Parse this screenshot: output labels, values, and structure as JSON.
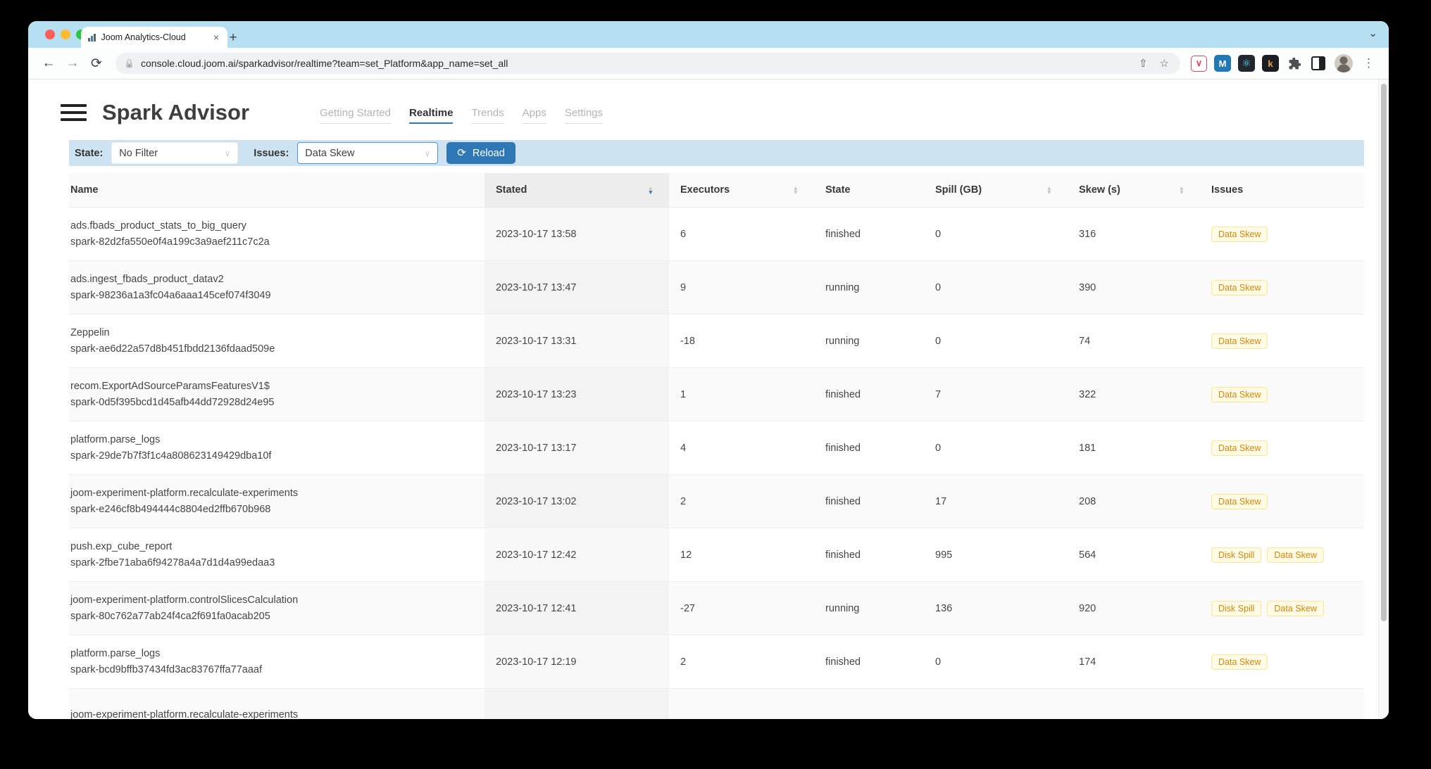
{
  "colors": {
    "accent_blue": "#2e78b5",
    "tabstrip_bg": "#b6e0f1",
    "filter_bar_bg": "#cde3f1",
    "badge_bg": "#fffbe6",
    "badge_border": "#ffe58f",
    "badge_text": "#d48806",
    "traffic_lights": [
      "#ff5f57",
      "#febc2e",
      "#28c840"
    ]
  },
  "icons": {
    "back": "←",
    "forward": "→",
    "reload": "⟳",
    "lock": "🔒",
    "share": "⇧",
    "star": "☆",
    "menu_dots": "⋮",
    "strip_chevron": "⌄",
    "select_chevron": "∨",
    "new_tab_plus": "+",
    "tab_close": "×",
    "caret_up": "▲",
    "caret_down": "▼",
    "reload_button": "⟳",
    "react_atom": "⚛",
    "pocket_chevron": "∨",
    "mattermost_letter": "M",
    "kibana_letter": "k"
  },
  "browser": {
    "tab_title": "Joom Analytics-Cloud",
    "url": "console.cloud.joom.ai/sparkadvisor/realtime?team=set_Platform&app_name=set_all"
  },
  "header": {
    "title": "Spark Advisor",
    "nav": [
      {
        "label": "Getting Started",
        "active": false
      },
      {
        "label": "Realtime",
        "active": true
      },
      {
        "label": "Trends",
        "active": false
      },
      {
        "label": "Apps",
        "active": false
      },
      {
        "label": "Settings",
        "active": false
      }
    ]
  },
  "filters": {
    "state_label": "State:",
    "state_value": "No Filter",
    "issues_label": "Issues:",
    "issues_value": "Data Skew",
    "reload_label": "Reload"
  },
  "table": {
    "columns": [
      {
        "key": "name",
        "label": "Name",
        "sortable": false,
        "sorted": null
      },
      {
        "key": "stated",
        "label": "Stated",
        "sortable": true,
        "sorted": "desc"
      },
      {
        "key": "executors",
        "label": "Executors",
        "sortable": true,
        "sorted": null
      },
      {
        "key": "state",
        "label": "State",
        "sortable": false,
        "sorted": null
      },
      {
        "key": "spill",
        "label": "Spill (GB)",
        "sortable": true,
        "sorted": null
      },
      {
        "key": "skew",
        "label": "Skew (s)",
        "sortable": true,
        "sorted": null
      },
      {
        "key": "issues",
        "label": "Issues",
        "sortable": false,
        "sorted": null
      }
    ],
    "rows": [
      {
        "name": "ads.fbads_product_stats_to_big_query",
        "id": "spark-82d2fa550e0f4a199c3a9aef211c7c2a",
        "stated": "2023-10-17 13:58",
        "executors": "6",
        "state": "finished",
        "spill": "0",
        "skew": "316",
        "issues": [
          "Data Skew"
        ]
      },
      {
        "name": "ads.ingest_fbads_product_datav2",
        "id": "spark-98236a1a3fc04a6aaa145cef074f3049",
        "stated": "2023-10-17 13:47",
        "executors": "9",
        "state": "running",
        "spill": "0",
        "skew": "390",
        "issues": [
          "Data Skew"
        ]
      },
      {
        "name": "Zeppelin",
        "id": "spark-ae6d22a57d8b451fbdd2136fdaad509e",
        "stated": "2023-10-17 13:31",
        "executors": "-18",
        "state": "running",
        "spill": "0",
        "skew": "74",
        "issues": [
          "Data Skew"
        ]
      },
      {
        "name": "recom.ExportAdSourceParamsFeaturesV1$",
        "id": "spark-0d5f395bcd1d45afb44dd72928d24e95",
        "stated": "2023-10-17 13:23",
        "executors": "1",
        "state": "finished",
        "spill": "7",
        "skew": "322",
        "issues": [
          "Data Skew"
        ]
      },
      {
        "name": "platform.parse_logs",
        "id": "spark-29de7b7f3f1c4a808623149429dba10f",
        "stated": "2023-10-17 13:17",
        "executors": "4",
        "state": "finished",
        "spill": "0",
        "skew": "181",
        "issues": [
          "Data Skew"
        ]
      },
      {
        "name": "joom-experiment-platform.recalculate-experiments",
        "id": "spark-e246cf8b494444c8804ed2ffb670b968",
        "stated": "2023-10-17 13:02",
        "executors": "2",
        "state": "finished",
        "spill": "17",
        "skew": "208",
        "issues": [
          "Data Skew"
        ]
      },
      {
        "name": "push.exp_cube_report",
        "id": "spark-2fbe71aba6f94278a4a7d1d4a99edaa3",
        "stated": "2023-10-17 12:42",
        "executors": "12",
        "state": "finished",
        "spill": "995",
        "skew": "564",
        "issues": [
          "Disk Spill",
          "Data Skew"
        ]
      },
      {
        "name": "joom-experiment-platform.controlSlicesCalculation",
        "id": "spark-80c762a77ab24f4ca2f691fa0acab205",
        "stated": "2023-10-17 12:41",
        "executors": "-27",
        "state": "running",
        "spill": "136",
        "skew": "920",
        "issues": [
          "Disk Spill",
          "Data Skew"
        ]
      },
      {
        "name": "platform.parse_logs",
        "id": "spark-bcd9bffb37434fd3ac83767ffa77aaaf",
        "stated": "2023-10-17 12:19",
        "executors": "2",
        "state": "finished",
        "spill": "0",
        "skew": "174",
        "issues": [
          "Data Skew"
        ]
      },
      {
        "name": "joom-experiment-platform.recalculate-experiments",
        "id": "",
        "stated": "",
        "executors": "",
        "state": "",
        "spill": "",
        "skew": "",
        "issues": []
      }
    ]
  }
}
